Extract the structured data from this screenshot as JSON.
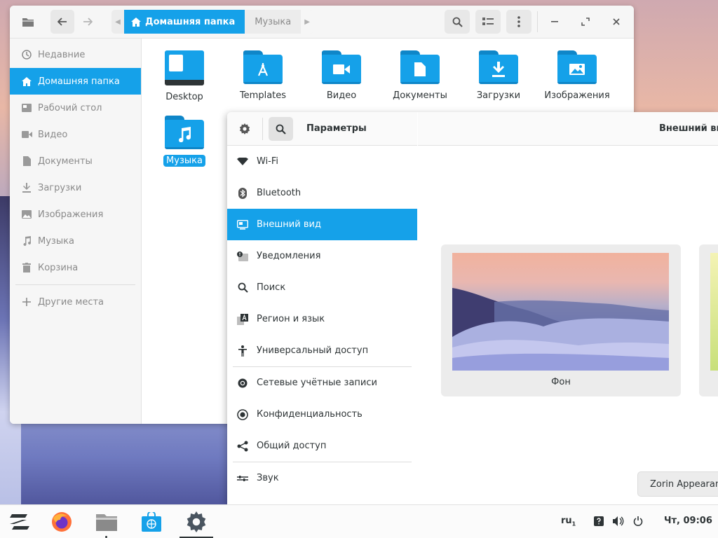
{
  "files": {
    "header": {
      "breadcrumb_home": "Домашняя папка",
      "breadcrumb_current": "Музыка"
    },
    "sidebar": {
      "items": [
        {
          "label": "Недавние",
          "icon": "clock-icon"
        },
        {
          "label": "Домашняя папка",
          "icon": "home-icon",
          "active": true
        },
        {
          "label": "Рабочий стол",
          "icon": "desktop-icon"
        },
        {
          "label": "Видео",
          "icon": "video-icon"
        },
        {
          "label": "Документы",
          "icon": "document-icon"
        },
        {
          "label": "Загрузки",
          "icon": "download-icon"
        },
        {
          "label": "Изображения",
          "icon": "image-icon"
        },
        {
          "label": "Музыка",
          "icon": "music-icon"
        },
        {
          "label": "Корзина",
          "icon": "trash-icon"
        }
      ],
      "other_places": "Другие места"
    },
    "items": [
      {
        "label": "Desktop",
        "icon": "desktop-folder-icon"
      },
      {
        "label": "Templates",
        "icon": "templates-folder-icon"
      },
      {
        "label": "Видео",
        "icon": "video-folder-icon"
      },
      {
        "label": "Документы",
        "icon": "documents-folder-icon"
      },
      {
        "label": "Загрузки",
        "icon": "downloads-folder-icon"
      },
      {
        "label": "Изображения",
        "icon": "pictures-folder-icon"
      },
      {
        "label": "Музыка",
        "icon": "music-folder-icon",
        "selected": true
      }
    ]
  },
  "settings": {
    "title": "Параметры",
    "right_title": "Внешний вид",
    "items": [
      {
        "label": "Wi-Fi",
        "icon": "wifi-icon"
      },
      {
        "label": "Bluetooth",
        "icon": "bluetooth-icon"
      },
      {
        "label": "Внешний вид",
        "icon": "appearance-icon",
        "active": true
      },
      {
        "label": "Уведомления",
        "icon": "notifications-icon"
      },
      {
        "label": "Поиск",
        "icon": "search-icon"
      },
      {
        "label": "Регион и язык",
        "icon": "region-icon"
      },
      {
        "label": "Универсальный доступ",
        "icon": "accessibility-icon"
      },
      {
        "label": "Сетевые учётные записи",
        "icon": "online-accounts-icon"
      },
      {
        "label": "Конфиденциальность",
        "icon": "privacy-icon"
      },
      {
        "label": "Общий доступ",
        "icon": "share-icon"
      },
      {
        "label": "Звук",
        "icon": "sound-icon"
      }
    ],
    "background_label": "Фон",
    "zorin_button": "Zorin Appearance"
  },
  "taskbar": {
    "keyboard_layout": "ru",
    "keyboard_layout_sub": "1",
    "clock": "Чт, 09:06"
  },
  "colors": {
    "accent": "#15a1e9"
  }
}
